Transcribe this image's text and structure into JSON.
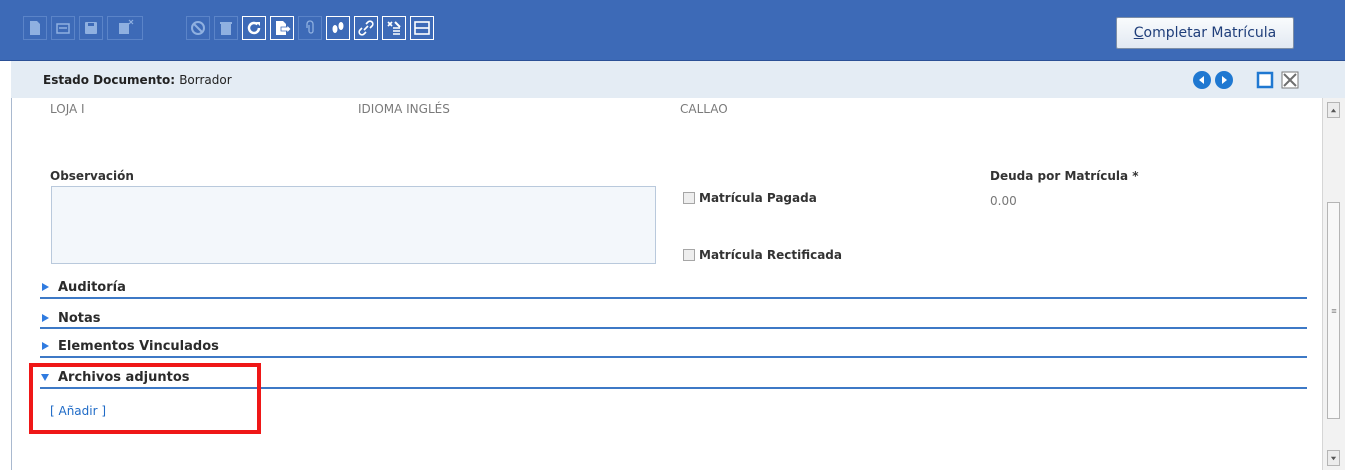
{
  "toolbar": {
    "tools": [
      {
        "icon": "new-document-icon"
      },
      {
        "icon": "copy-record-icon"
      },
      {
        "icon": "save-icon"
      },
      {
        "icon": "delete-selection-icon"
      },
      {
        "icon": "cancel-icon"
      },
      {
        "icon": "trash-icon"
      },
      {
        "icon": "refresh-icon"
      },
      {
        "icon": "export-icon"
      },
      {
        "icon": "attachment-icon"
      },
      {
        "icon": "footprints-icon"
      },
      {
        "icon": "link-icon"
      },
      {
        "icon": "tools-icon"
      },
      {
        "icon": "form-view-icon"
      }
    ],
    "complete_button": {
      "accel": "C",
      "rest": "ompletar Matrícula"
    }
  },
  "status": {
    "label": "Estado Documento:",
    "value": "Borrador"
  },
  "top_row": {
    "col1": "LOJA I",
    "col2": "IDIOMA INGLÉS",
    "col3": "CALLAO"
  },
  "form": {
    "observation_label": "Observación",
    "observation_value": "",
    "paid_label": "Matrícula Pagada",
    "rectified_label": "Matrícula Rectificada",
    "debt_label": "Deuda por Matrícula *",
    "debt_value": "0.00"
  },
  "sections": [
    {
      "label": "Auditoría",
      "expanded": false
    },
    {
      "label": "Notas",
      "expanded": false
    },
    {
      "label": "Elementos Vinculados",
      "expanded": false
    },
    {
      "label": "Archivos adjuntos",
      "expanded": true
    }
  ],
  "attachments": {
    "add_link": "[ Añadir ]"
  },
  "colors": {
    "toolbar_bg": "#3d6ab7",
    "section_line": "#3d79c6",
    "link": "#1f6bc7",
    "highlight": "#ef1717"
  }
}
